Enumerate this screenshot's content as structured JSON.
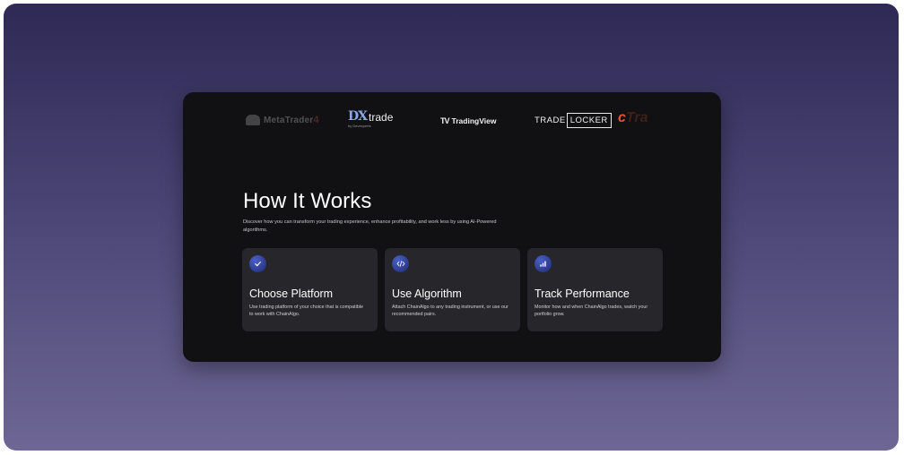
{
  "logos": {
    "metatrader": {
      "name": "MetaTrader",
      "number": "4",
      "icon": "metatrader-logo-icon"
    },
    "dxtrade": {
      "mark": "DX",
      "word": "trade",
      "by": "by Devexperts",
      "icon": "dxtrade-logo-icon"
    },
    "tradingview": {
      "mark": "TV",
      "name": "TradingView",
      "icon": "tradingview-logo-icon"
    },
    "tradelocker": {
      "left": "TRADE",
      "boxed": "LOCKER",
      "icon": "tradelocker-logo-icon"
    },
    "ctrader": {
      "c": "c",
      "rest": "Tra",
      "icon": "ctrader-logo-icon"
    }
  },
  "section": {
    "title": "How It Works",
    "subtitle": "Discover how you can transform your trading experience, enhance profitability, and work less by using AI-Powered algorithms."
  },
  "steps": [
    {
      "icon": "checkmark-icon",
      "title": "Choose Platform",
      "description": "Use trading platform of your choice that is compatible to work with ChainAlgo."
    },
    {
      "icon": "code-icon",
      "title": "Use Algorithm",
      "description": "Attach ChainAlgo to any trading instrument, or use our recommended pairs."
    },
    {
      "icon": "bar-chart-icon",
      "title": "Track Performance",
      "description": "Monitor how and when ChainAlgo trades, watch your portfolio grow."
    }
  ],
  "colors": {
    "background_top": "#2f2955",
    "background_bottom": "#6e6795",
    "card": "#111113",
    "step_card": "#27272b",
    "icon_accent": "#3546a8",
    "ctrader_accent": "#e4572e"
  }
}
